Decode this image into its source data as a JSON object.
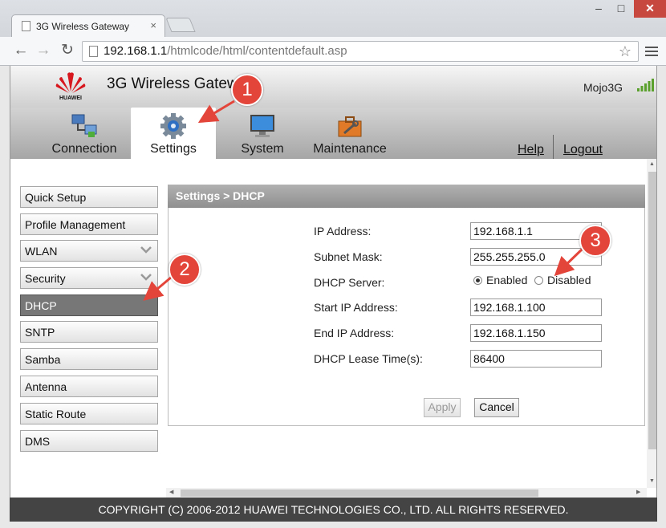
{
  "browser": {
    "tab_title": "3G Wireless Gateway",
    "tab_close": "×",
    "url_host": "192.168.1.1",
    "url_path": "/htmlcode/html/contentdefault.asp",
    "win_min": "–",
    "win_max": "□",
    "win_close": "✕",
    "back": "←",
    "forward": "→",
    "reload": "↻",
    "star": "☆"
  },
  "header": {
    "brand": "HUAWEI",
    "title": "3G Wireless Gateway",
    "user": "Mojo3G"
  },
  "nav": {
    "items": [
      {
        "label": "Connection",
        "icon": "network-computers-icon"
      },
      {
        "label": "Settings",
        "icon": "gear-icon"
      },
      {
        "label": "System",
        "icon": "monitor-icon"
      },
      {
        "label": "Maintenance",
        "icon": "toolbox-icon"
      }
    ],
    "help": "Help",
    "logout": "Logout"
  },
  "sidebar": {
    "items": [
      {
        "label": "Quick Setup"
      },
      {
        "label": "Profile Management"
      },
      {
        "label": "WLAN"
      },
      {
        "label": "Security"
      },
      {
        "label": "DHCP"
      },
      {
        "label": "SNTP"
      },
      {
        "label": "Samba"
      },
      {
        "label": "Antenna"
      },
      {
        "label": "Static Route"
      },
      {
        "label": "DMS"
      }
    ],
    "active": "DHCP"
  },
  "content": {
    "section_title": "Settings > DHCP",
    "fields": [
      {
        "label": "IP Address:",
        "value": "192.168.1.1"
      },
      {
        "label": "Subnet Mask:",
        "value": "255.255.255.0"
      },
      {
        "label": "DHCP Server:"
      },
      {
        "label": "Start IP Address:",
        "value": "192.168.1.100"
      },
      {
        "label": "End IP Address:",
        "value": "192.168.1.150"
      },
      {
        "label": "DHCP Lease Time(s):",
        "value": "86400"
      }
    ],
    "dhcp_server": {
      "options": [
        "Enabled",
        "Disabled"
      ],
      "selected": "Enabled"
    },
    "apply": "Apply",
    "cancel": "Cancel"
  },
  "footer": {
    "copyright": "COPYRIGHT (C) 2006-2012 HUAWEI TECHNOLOGIES CO., LTD. ALL RIGHTS RESERVED."
  },
  "annotations": {
    "badges": [
      "1",
      "2",
      "3"
    ],
    "color": "#e4453b"
  },
  "colors": {
    "footer_bg": "#444444",
    "active_sidebar": "#777777",
    "signal": "#5aa02c",
    "huawei_red": "#d7181f"
  }
}
